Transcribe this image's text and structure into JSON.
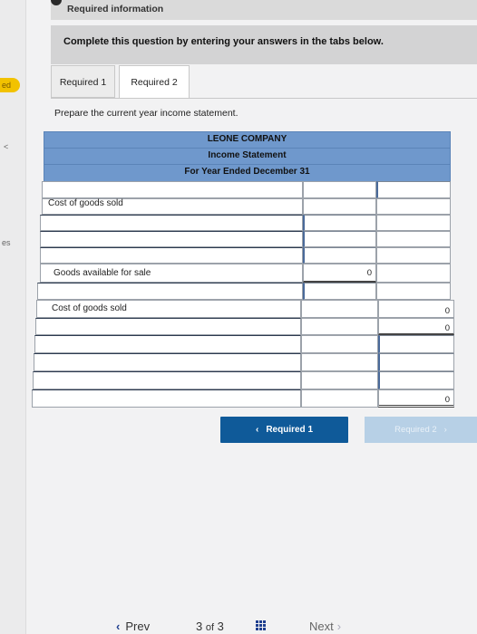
{
  "sidebar": {
    "badge": "ed",
    "glyph_1": "<",
    "glyph_2": "es"
  },
  "header": {
    "required_info": "Required information"
  },
  "instruction": "Complete this question by entering your answers in the tabs below.",
  "tabs": [
    {
      "label": "Required 1"
    },
    {
      "label": "Required 2"
    }
  ],
  "prompt": "Prepare the current year income statement.",
  "statement": {
    "company": "LEONE COMPANY",
    "title": "Income Statement",
    "period": "For Year Ended December 31"
  },
  "rows": [
    {
      "label": "",
      "mid": "",
      "right": ""
    },
    {
      "label": "Cost of goods sold",
      "mid": "",
      "right": ""
    },
    {
      "label": "",
      "mid": "",
      "right": ""
    },
    {
      "label": "",
      "mid": "",
      "right": ""
    },
    {
      "label": "",
      "mid": "",
      "right": ""
    },
    {
      "label": "Goods available for sale",
      "mid": "0",
      "right": ""
    },
    {
      "label": "",
      "mid": "",
      "right": ""
    },
    {
      "label": "Cost of goods sold",
      "mid": "",
      "right": "0"
    },
    {
      "label": "",
      "mid": "",
      "right": "0"
    },
    {
      "label": "",
      "mid": "",
      "right": ""
    },
    {
      "label": "",
      "mid": "",
      "right": ""
    },
    {
      "label": "",
      "mid": "",
      "right": ""
    },
    {
      "label": "",
      "mid": "$",
      "right": "0"
    }
  ],
  "nav": {
    "prev_tab": "Required 1",
    "next_tab": "Required 2",
    "prev": "Prev",
    "page_current": "3",
    "page_of": "of",
    "page_total": "3",
    "next": "Next"
  }
}
